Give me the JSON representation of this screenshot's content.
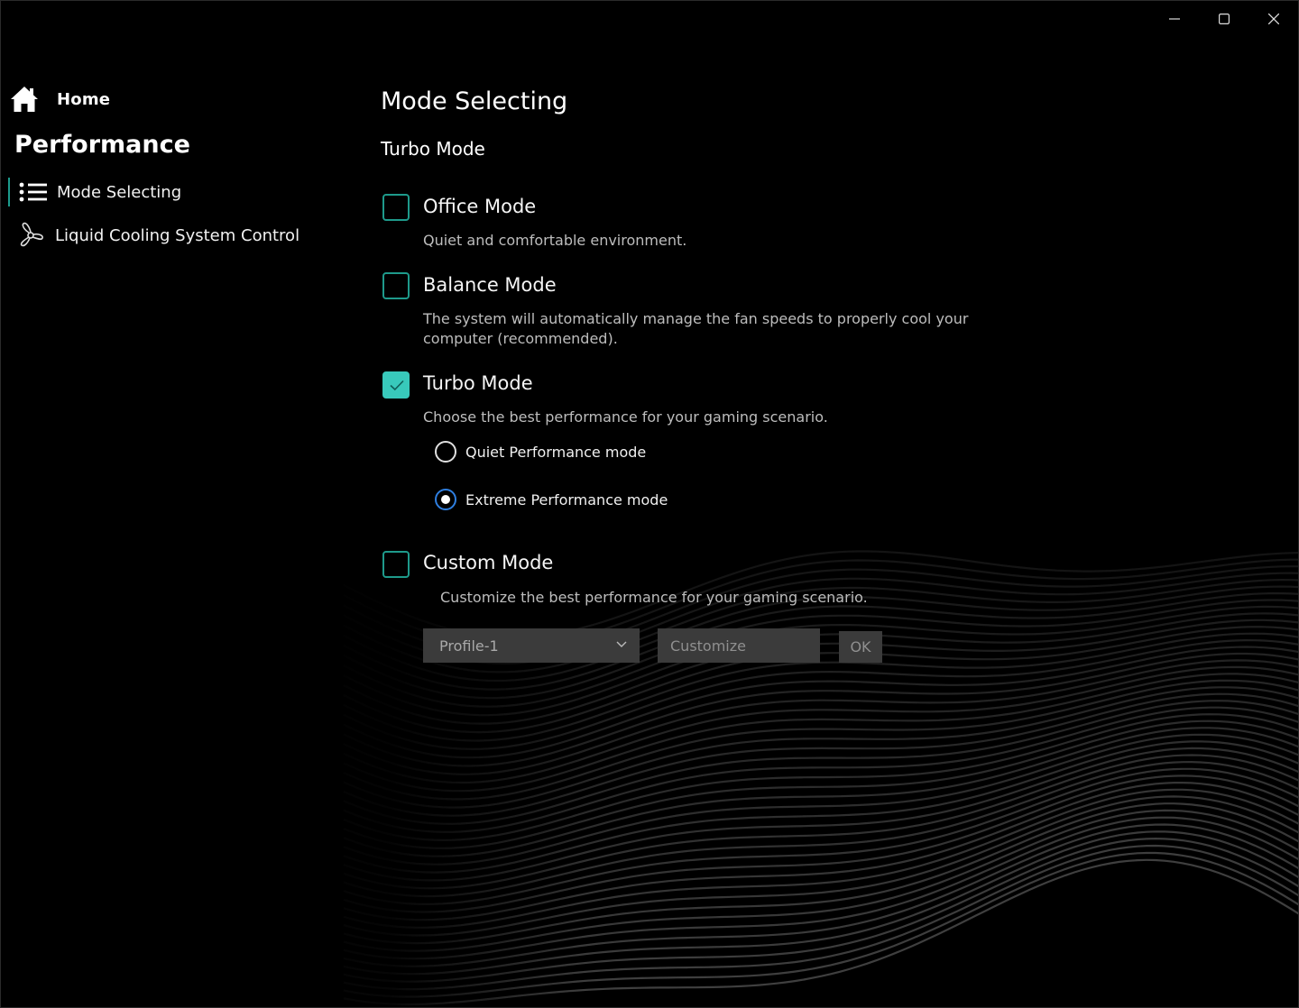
{
  "window": {
    "controls": [
      "minimize-icon",
      "maximize-icon",
      "close-icon"
    ]
  },
  "sidebar": {
    "home_label": "Home",
    "section_title": "Performance",
    "items": [
      {
        "label": "Mode Selecting",
        "icon": "list-icon",
        "active": true
      },
      {
        "label": "Liquid Cooling System Control",
        "icon": "fan-icon",
        "active": false
      }
    ]
  },
  "main": {
    "title": "Mode Selecting",
    "current_mode": "Turbo Mode",
    "modes": [
      {
        "label": "Office Mode",
        "description": "Quiet and comfortable environment.",
        "checked": false
      },
      {
        "label": "Balance Mode",
        "description": "The system will automatically manage the fan speeds to properly cool your computer (recommended).",
        "checked": false
      },
      {
        "label": "Turbo Mode",
        "description": "Choose the best performance for your gaming scenario.",
        "checked": true
      },
      {
        "label": "Custom Mode",
        "description": "Customize the best performance for your gaming scenario.",
        "checked": false
      }
    ],
    "turbo_options": [
      {
        "label": "Quiet Performance mode",
        "selected": false
      },
      {
        "label": "Extreme Performance mode",
        "selected": true
      }
    ],
    "custom": {
      "profile_value": "Profile-1",
      "customize_label": "Customize",
      "ok_label": "OK"
    }
  },
  "colors": {
    "accent": "#38c9bb",
    "checkbox_border": "#1e9a8b",
    "radio_selected": "#2f7fe0",
    "background": "#000000",
    "control_bg": "#3b3b3b"
  }
}
